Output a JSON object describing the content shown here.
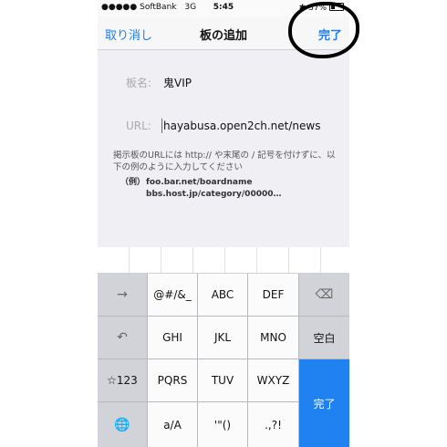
{
  "status_bar": {
    "carrier": "●●●●● SoftBank",
    "network": "3G",
    "time": "5:45",
    "bluetooth_icon": "bluetooth-icon",
    "battery": "37%"
  },
  "nav": {
    "cancel_label": "取り消し",
    "title": "板の追加",
    "done_label": "完了"
  },
  "form": {
    "board_name_label": "板名:",
    "board_name_value": "鬼VIP",
    "url_label": "URL:",
    "url_value": "hayabusa.open2ch.net/news",
    "note": "掲示板のURLには http:// や末尾の / 記号を付けずに、以下の例のように入力してください",
    "example_prefix": "（例）",
    "example_1": "foo.bar.net/boardname",
    "example_2": "bbs.host.jp/category/00000…"
  },
  "keyboard": {
    "row1": [
      "→",
      "@#/&_",
      "ABC",
      "DEF",
      "⌫"
    ],
    "row2": [
      "↶",
      "GHI",
      "JKL",
      "MNO",
      "空白"
    ],
    "row3": [
      "☆123",
      "PQRS",
      "TUV",
      "WXYZ"
    ],
    "row4": [
      "🌐",
      "a/A",
      "'\"()",
      ".,?!"
    ],
    "done_label": "完了",
    "icons": {
      "next": "arrow-right-icon",
      "delete": "backspace-icon",
      "undo": "undo-icon",
      "globe": "globe-icon"
    }
  },
  "colors": {
    "accent": "#1a7cf0",
    "done_key": "#1f82f0",
    "form_bg": "#efeff4",
    "keyboard_bg": "#c9ccd1"
  }
}
